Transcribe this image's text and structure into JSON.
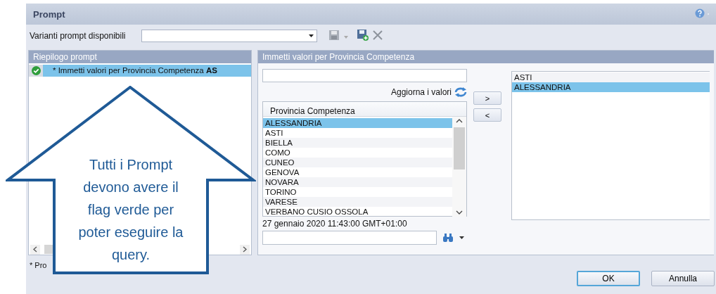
{
  "dialog": {
    "title": "Prompt"
  },
  "variants": {
    "label": "Varianti prompt disponibili"
  },
  "summary": {
    "title": "Riepilogo prompt",
    "items": [
      {
        "text": "* Immetti valori per Provincia Competenza **AS**",
        "selected": true,
        "complete": true
      }
    ]
  },
  "values_panel": {
    "title": "Immetti valori per Provincia Competenza",
    "refresh_label": "Aggiorna i valori",
    "list_header": "Provincia Competenza",
    "available": [
      {
        "name": "ALESSANDRIA",
        "selected": true
      },
      {
        "name": "ASTI",
        "selected": false
      },
      {
        "name": "BIELLA",
        "selected": false
      },
      {
        "name": "COMO",
        "selected": false
      },
      {
        "name": "CUNEO",
        "selected": false
      },
      {
        "name": "GENOVA",
        "selected": false
      },
      {
        "name": "NOVARA",
        "selected": false
      },
      {
        "name": "TORINO",
        "selected": false
      },
      {
        "name": "VARESE",
        "selected": false
      },
      {
        "name": "VERBANO CUSIO OSSOLA",
        "selected": false
      }
    ],
    "timestamp": "27 gennaio 2020 11:43:00 GMT+01:00",
    "add_button": ">",
    "remove_button": "<",
    "chosen": [
      {
        "name": "ASTI",
        "selected": false
      },
      {
        "name": "ALESSANDRIA",
        "selected": true
      }
    ]
  },
  "footnote": "* Pro",
  "buttons": [
    {
      "label": "OK",
      "focused": true
    },
    {
      "label": "Annulla",
      "focused": false
    }
  ],
  "callout": {
    "text": "Tutti i Prompt devono avere il flag verde per poter eseguire la query."
  }
}
